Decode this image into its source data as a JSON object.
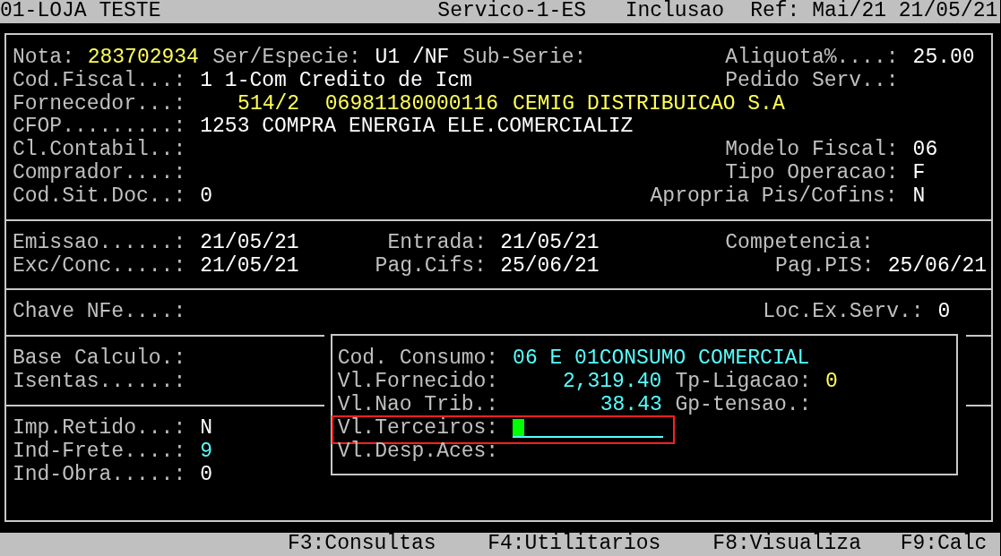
{
  "title_bar": {
    "store": "01-LOJA TESTE",
    "screen": "Servico-1-ES",
    "mode": "Inclusao",
    "reference": "Ref: Mai/21 21/05/21"
  },
  "header": [
    {
      "label": "Nota:",
      "values": [
        {
          "text": "283702934",
          "color": "#ffff55"
        }
      ]
    },
    {
      "label": "Ser/Especie:",
      "values": [
        {
          "text": "U1 /NF",
          "color": "#ffffff"
        }
      ]
    },
    {
      "label": "Sub-Serie:"
    },
    {
      "label": "Aliquota%....:",
      "values": [
        {
          "text": "25.00",
          "color": "#ffffff"
        }
      ]
    },
    {
      "label": "Cod.Fiscal...:",
      "values": [
        {
          "text": "1 1-Com Credito de Icm",
          "color": "#ffffff"
        }
      ]
    },
    {
      "label": "Pedido Serv..:"
    },
    {
      "label": "Fornecedor...:",
      "values": [
        {
          "text": "514/2",
          "color": "#ffff55"
        },
        {
          "text": "06981180000116",
          "color": "#ffff55"
        },
        {
          "text": "CEMIG DISTRIBUICAO S.A",
          "color": "#ffff55"
        }
      ]
    },
    {
      "label": "CFOP.........:",
      "values": [
        {
          "text": "1253 COMPRA ENERGIA ELE.COMERCIALIZ",
          "color": "#ffffff"
        }
      ]
    },
    {
      "label": "Cl.Contabil..:"
    },
    {
      "label": "Modelo Fiscal:",
      "values": [
        {
          "text": "06",
          "color": "#ffffff"
        }
      ]
    },
    {
      "label": "Comprador....:"
    },
    {
      "label": "Tipo Operacao:",
      "values": [
        {
          "text": "F",
          "color": "#ffffff"
        }
      ]
    },
    {
      "label": "Cod.Sit.Doc..:",
      "values": [
        {
          "text": "0",
          "color": "#ffffff"
        }
      ]
    },
    {
      "label": "Apropria Pis/Cofins:",
      "values": [
        {
          "text": "N",
          "color": "#ffffff"
        }
      ]
    }
  ],
  "dates": [
    {
      "label": "Emissao......:",
      "values": [
        {
          "text": "21/05/21",
          "color": "#ffffff"
        }
      ]
    },
    {
      "label": "Entrada:",
      "values": [
        {
          "text": "21/05/21",
          "color": "#ffffff"
        }
      ]
    },
    {
      "label": "Competencia:"
    },
    {
      "label": "Exc/Conc.....:",
      "values": [
        {
          "text": "21/05/21",
          "color": "#ffffff"
        }
      ]
    },
    {
      "label": "Pag.Cifs:",
      "values": [
        {
          "text": "25/06/21",
          "color": "#ffffff"
        }
      ]
    },
    {
      "label": "Pag.PIS:",
      "values": [
        {
          "text": "25/06/21",
          "color": "#ffffff"
        }
      ]
    }
  ],
  "nfe": [
    {
      "label": "Chave NFe....:"
    },
    {
      "label": "Loc.Ex.Serv.:",
      "values": [
        {
          "text": "0",
          "color": "#ffffff"
        }
      ]
    }
  ],
  "totals": [
    {
      "label": "Base Calculo.:"
    },
    {
      "label": "Isentas......:"
    }
  ],
  "indicators": [
    {
      "label": "Imp.Retido...:",
      "values": [
        {
          "text": "N",
          "color": "#ffffff"
        }
      ]
    },
    {
      "label": "Ind-Frete....:",
      "values": [
        {
          "text": "9",
          "color": "#55ffff"
        }
      ]
    },
    {
      "label": "Ind-Obra.....:",
      "values": [
        {
          "text": "0",
          "color": "#ffffff"
        }
      ]
    }
  ],
  "consumption": [
    {
      "kind": "text",
      "label": "Cod. Consumo:",
      "values": [
        {
          "text": "06 E 01CONSUMO COMERCIAL",
          "color": "#55ffff"
        }
      ]
    },
    {
      "kind": "text",
      "label": "Vl.Fornecido:",
      "values": [
        {
          "text": "2,319.40",
          "color": "#55ffff"
        }
      ]
    },
    {
      "kind": "text",
      "label": "Tp-Ligacao:",
      "values": [
        {
          "text": "0",
          "color": "#ffff55"
        }
      ]
    },
    {
      "kind": "text",
      "label": "Vl.Nao Trib.:",
      "values": [
        {
          "text": "38.43",
          "color": "#55ffff"
        }
      ]
    },
    {
      "kind": "text",
      "label": "Gp-tensao.:"
    },
    {
      "kind": "input",
      "label": "Vl.Terceiros:",
      "highlighted": true
    },
    {
      "kind": "text",
      "label": "Vl.Desp.Aces:"
    }
  ],
  "function_keys": [
    "F3:Consultas",
    "F4:Utilitarios",
    "F8:Visualiza",
    "F9:Calc"
  ]
}
